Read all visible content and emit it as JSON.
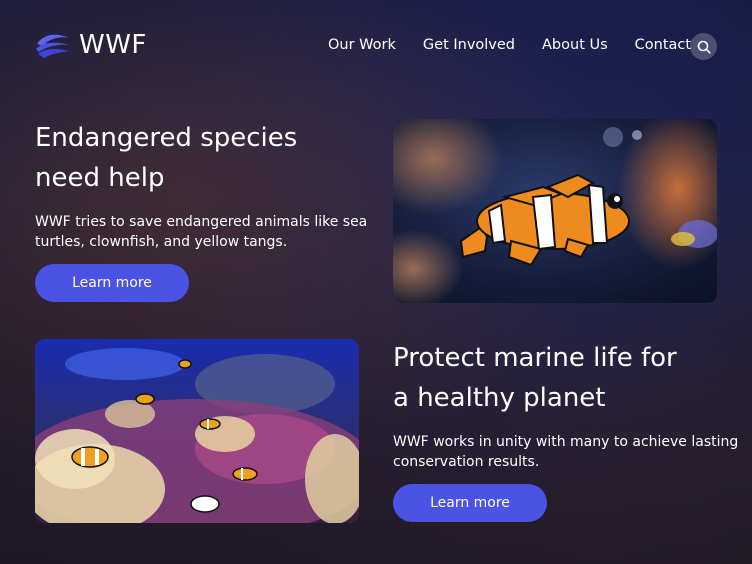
{
  "brand": {
    "name": "WWF",
    "accent": "#4b53e4"
  },
  "nav": {
    "links": [
      "Our Work",
      "Get Involved",
      "About Us",
      "Contact"
    ],
    "search_icon": "search-icon"
  },
  "section1": {
    "headline_line1": "Endangered species",
    "headline_line2": "need help",
    "body_line1": "WWF tries to save endangered animals like sea",
    "body_line2": "turtles, clownfish, and yellow tangs.",
    "button": "Learn more",
    "image": "clownfish-photo"
  },
  "section2": {
    "headline_line1": "Protect marine life for",
    "headline_line2": "a healthy planet",
    "body_line1": "WWF works in unity with many to achieve lasting",
    "body_line2": "conservation results.",
    "button": "Learn more",
    "image": "coral-reef-photo"
  }
}
